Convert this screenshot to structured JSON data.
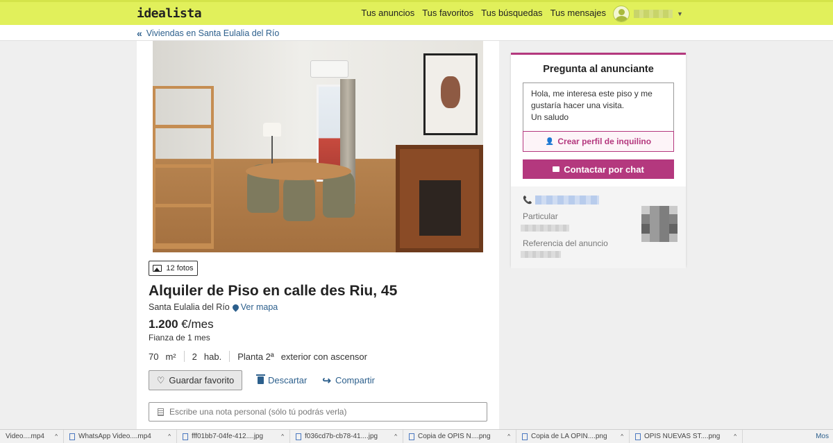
{
  "header": {
    "logo": "idealista",
    "nav": [
      "Tus anuncios",
      "Tus favoritos",
      "Tus búsquedas",
      "Tus mensajes"
    ],
    "accent_color": "#e1f05b"
  },
  "breadcrumb": {
    "label": "Viviendas en Santa Eulalia del Río"
  },
  "listing": {
    "photos_label": "12 fotos",
    "title": "Alquiler de Piso en calle des Riu, 45",
    "location": "Santa Eulalia del Río",
    "map_link": "Ver mapa",
    "price": "1.200",
    "price_unit": "€/mes",
    "deposit": "Fianza de 1 mes",
    "features": {
      "area_value": "70",
      "area_unit": "m²",
      "rooms_value": "2",
      "rooms_unit": "hab.",
      "floor": "Planta 2ª",
      "floor_extra": "exterior con ascensor"
    },
    "actions": {
      "save": "Guardar favorito",
      "discard": "Descartar",
      "share": "Compartir"
    },
    "note_placeholder": "Escribe una nota personal (sólo tú podrás verla)"
  },
  "contact": {
    "title": "Pregunta al anunciante",
    "message": "Hola, me interesa este piso y me\ngustaría hacer una visita.\nUn saludo",
    "profile_button": "Crear perfil de inquilino",
    "chat_button": "Contactar por chat",
    "advertiser_type": "Particular",
    "reference_label": "Referencia del anuncio",
    "accent_color": "#b4387e"
  },
  "downloads": {
    "items": [
      "Video....mp4",
      "WhatsApp Video....mp4",
      "fff01bb7-04fe-412....jpg",
      "f036cd7b-cb78-41....jpg",
      "Copia de OPIS N....png",
      "Copia de LA OPIN....png",
      "OPIS NUEVAS ST....png"
    ],
    "more": "Mos"
  }
}
